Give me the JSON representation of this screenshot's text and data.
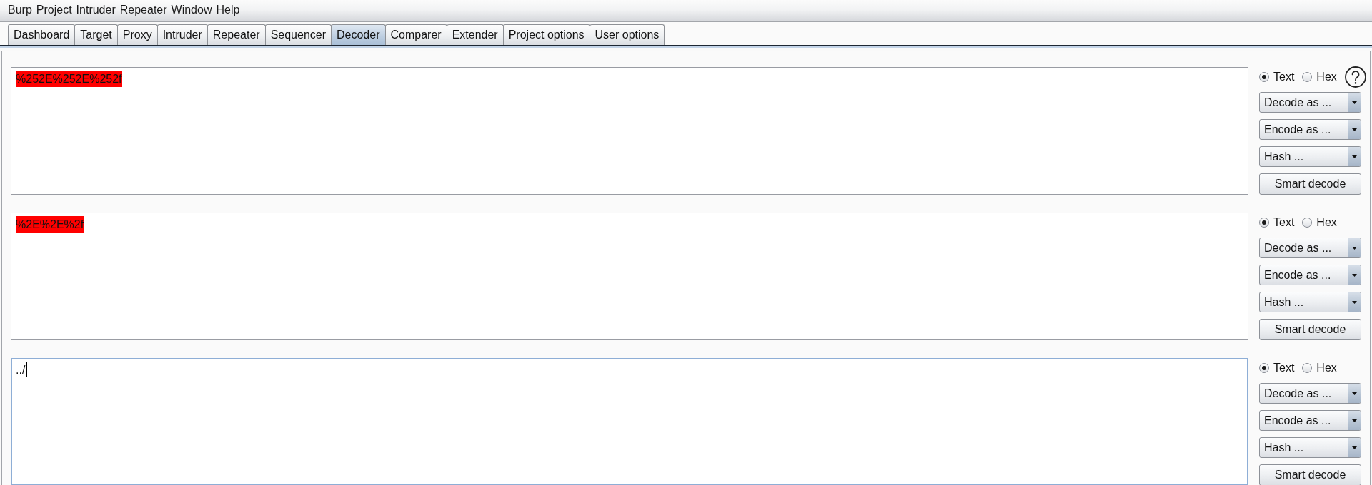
{
  "menu_bar": [
    "Burp",
    "Project",
    "Intruder",
    "Repeater",
    "Window",
    "Help"
  ],
  "tabs": [
    {
      "label": "Dashboard",
      "selected": false
    },
    {
      "label": "Target",
      "selected": false
    },
    {
      "label": "Proxy",
      "selected": false
    },
    {
      "label": "Intruder",
      "selected": false
    },
    {
      "label": "Repeater",
      "selected": false
    },
    {
      "label": "Sequencer",
      "selected": false
    },
    {
      "label": "Decoder",
      "selected": true
    },
    {
      "label": "Comparer",
      "selected": false
    },
    {
      "label": "Extender",
      "selected": false
    },
    {
      "label": "Project options",
      "selected": false
    },
    {
      "label": "User options",
      "selected": false
    }
  ],
  "decoder_panels": [
    {
      "text": "%252E%252E%252f",
      "highlighted": true,
      "focused": false,
      "formats": [
        {
          "label": "Text",
          "selected": true
        },
        {
          "label": "Hex",
          "selected": false
        }
      ],
      "help_icon": true,
      "dropdowns": [
        "Decode as ...",
        "Encode as ...",
        "Hash ..."
      ],
      "button": "Smart decode"
    },
    {
      "text": "%2E%2E%2f",
      "highlighted": true,
      "focused": false,
      "formats": [
        {
          "label": "Text",
          "selected": true
        },
        {
          "label": "Hex",
          "selected": false
        }
      ],
      "help_icon": false,
      "dropdowns": [
        "Decode as ...",
        "Encode as ...",
        "Hash ..."
      ],
      "button": "Smart decode"
    },
    {
      "text": "../",
      "highlighted": false,
      "focused": true,
      "formats": [
        {
          "label": "Text",
          "selected": true
        },
        {
          "label": "Hex",
          "selected": false
        }
      ],
      "help_icon": false,
      "dropdowns": [
        "Decode as ...",
        "Encode as ...",
        "Hash ..."
      ],
      "button": "Smart decode"
    }
  ]
}
